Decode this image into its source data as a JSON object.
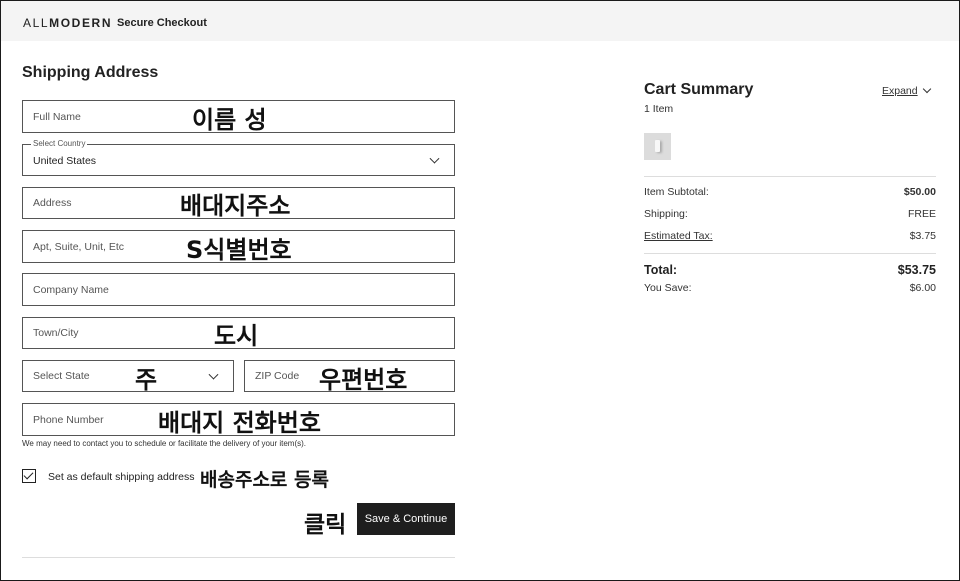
{
  "header": {
    "logo_light": "ALL",
    "logo_bold": "MODERN",
    "title": "Secure Checkout"
  },
  "shipping": {
    "title": "Shipping Address",
    "full_name": {
      "placeholder": "Full Name",
      "annotation": "이름 성"
    },
    "country": {
      "label": "Select Country",
      "value": "United States"
    },
    "address": {
      "placeholder": "Address",
      "annotation": "배대지주소"
    },
    "apt": {
      "placeholder": "Apt, Suite, Unit, Etc",
      "annotation": "S식별번호"
    },
    "company": {
      "placeholder": "Company Name"
    },
    "city": {
      "placeholder": "Town/City",
      "annotation": "도시"
    },
    "state": {
      "placeholder": "Select State",
      "annotation": "주"
    },
    "zip": {
      "placeholder": "ZIP Code",
      "annotation": "우편번호"
    },
    "phone": {
      "placeholder": "Phone Number",
      "annotation": "배대지 전화번호"
    },
    "helper_text": "We may need to contact you to schedule or facilitate the delivery of your item(s).",
    "default_checkbox": {
      "label": "Set as default shipping address",
      "checked": true,
      "annotation": "배송주소로 등록"
    },
    "save_button": {
      "label": "Save & Continue",
      "annotation": "클릭"
    }
  },
  "cart": {
    "title": "Cart Summary",
    "item_count": "1 Item",
    "expand_label": "Expand",
    "rows": [
      {
        "label": "Item Subtotal:",
        "value": "$50.00"
      },
      {
        "label": "Shipping:",
        "value": "FREE"
      },
      {
        "label": "Estimated Tax:",
        "value": "$3.75"
      }
    ],
    "total": {
      "label": "Total:",
      "value": "$53.75"
    },
    "savings": {
      "label": "You Save:",
      "value": "$6.00"
    }
  }
}
